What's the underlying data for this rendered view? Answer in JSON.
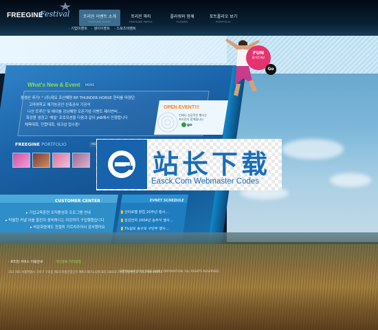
{
  "brand": {
    "logo_text": "FREEGINE",
    "logo_script": "Festival"
  },
  "nav": {
    "items": [
      {
        "label": "프리진 이벤트 소개",
        "sub": "FREEGINE EVENT",
        "active": true
      },
      {
        "label": "프리진 파티",
        "sub": "FREEGINE PARTIE",
        "active": false
      },
      {
        "label": "플라워와 함께",
        "sub": "FLOWER",
        "active": false
      },
      {
        "label": "포트폴리오 보기",
        "sub": "PORTFOLIO",
        "active": false
      }
    ],
    "subitems": [
      "기업이벤트",
      "생이이벤트",
      "스포츠이벤트"
    ]
  },
  "whats_new": {
    "title": "What's New & Event",
    "more": "MORE",
    "lines": [
      "동생산 추가! \" (주)데오 조산해양 BP THUNDER HORSE 헌터를 마쳤던",
      "고마여학교 애기농공산 신축공사 기공식",
      "나산 트루간 및 애이를 강남해양 오픈기념 이벤트 제이번비...",
      "화강용 냉장고 '채발' 프로모션을 다음과 같이 JAB에서 진행합니다",
      "체육대회, 단합대회, 워크샵 접수중!"
    ]
  },
  "open_event": {
    "title": "OPEN EVENT!!!",
    "desc": [
      "언제나 성공적인 행사는",
      "프리진이 함께합니다"
    ],
    "go": "go"
  },
  "portfolio": {
    "title": "FREEGINE",
    "title_suffix": "PORTFOLIO",
    "more": "MORE",
    "thumb_colors": [
      "#cf4fa6",
      "#7a3a3a",
      "#d6739d",
      "#9a6a90",
      "#a55060"
    ]
  },
  "customer_center": {
    "title": "CUSTOMER CENTER",
    "lines": [
      "기업교육훈련 조직활성화 프로그램 안내",
      "탁월한 커넬 이를 들진이 광비하니는 이강까지 구입햄했습니다",
      "비문화중에도 친절히 가르치주어서 감사했어요"
    ]
  },
  "evnet_schedule": {
    "title": "EVNET SCHEDULE",
    "lines": [
      "산타로텔 창립 20주년 행사...",
      "삼성전자 2004년 송무식 행사...",
      "T&실보 송구모 구단주 행사..."
    ]
  },
  "fun_badge": {
    "label": "FUN",
    "sub": "즐거운세상",
    "go": "Go"
  },
  "footer": {
    "links": [
      {
        "label": "프리진 서비스 이용안내"
      },
      {
        "label": "개인정보 처리방침"
      }
    ],
    "address": "152-785 서울특별시 구로구 구로동 제2디지털산업단지 에이스테크노타워 8차 1003호, 사업자등록번호 : 211-86-01071",
    "copyright": "COPYRIGHT 2004 FREE GINE CORPORATION. ALL RIGHTS RESERVED."
  },
  "watermark": {
    "cn": "站长下载",
    "en": "Easck.Com Webmaster Codes"
  },
  "colors": {
    "accent_blue": "#1b63a8",
    "event_orange": "#ff7a1a",
    "fun_pink": "#e6326e",
    "green_title": "#8fe04a"
  }
}
